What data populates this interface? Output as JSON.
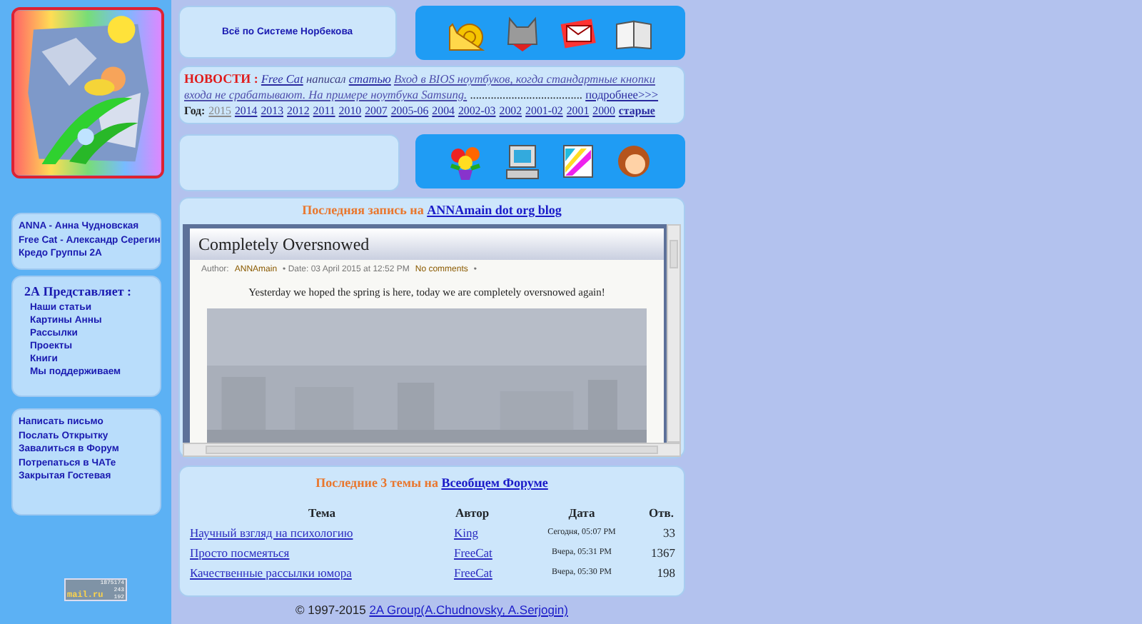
{
  "top_link": "Всё по Системе Норбекова",
  "news": {
    "label": "НОВОСТИ :",
    "author": "Free Cat",
    "verb": "написал",
    "article": "статью",
    "headline": [
      "Вход в BIOS ноутбуков, когда стандартные кнопки",
      "входа не срабатывают. На примере ноутбука Samsung."
    ],
    "dots": "......................................",
    "more": "подробнее>>>",
    "year_label": "Год:",
    "years": [
      {
        "label": "2015",
        "selected": true
      },
      {
        "label": "2014",
        "selected": false
      },
      {
        "label": "2013",
        "selected": false
      },
      {
        "label": "2012",
        "selected": false
      },
      {
        "label": "2011",
        "selected": false
      },
      {
        "label": "2010",
        "selected": false
      },
      {
        "label": "2007",
        "selected": false
      },
      {
        "label": "2005-06",
        "selected": false
      },
      {
        "label": "2004",
        "selected": false
      },
      {
        "label": "2002-03",
        "selected": false
      },
      {
        "label": "2002",
        "selected": false
      },
      {
        "label": "2001-02",
        "selected": false
      },
      {
        "label": "2001",
        "selected": false
      },
      {
        "label": "2000",
        "selected": false
      }
    ],
    "archive": "старые"
  },
  "sidebar": {
    "people": [
      "ANNA - Анна Чудновская",
      "Free Cat - Александр Серегин",
      "Кредо Группы 2A"
    ],
    "presents_title": "2А Представляет :",
    "presents": [
      "Наши статьи",
      "Картины Анны",
      "Рассылки",
      "Проекты",
      "Книги",
      "Мы поддерживаем"
    ],
    "contact": [
      "Написать письмо",
      "Послать Открытку",
      "Завалиться в Форум",
      "Потрепаться в ЧАТе",
      "Закрытая Гостевая"
    ],
    "counter": {
      "total": "1875174",
      "brand": "mail.ru",
      "values": [
        "243",
        "192"
      ]
    }
  },
  "blog": {
    "prefix": "Последняя запись на",
    "link": "ANNAmain dot org blog",
    "title": "Completely Oversnowed",
    "author_label": "Author:",
    "author": "ANNAmain",
    "date": "• Date: 03 April 2015 at 12:52 PM",
    "comments": "No comments",
    "tail": "•",
    "body": "Yesterday we hoped the spring is here, today we are completely oversnowed again!"
  },
  "forum": {
    "prefix": "Последние 3 темы на",
    "link": "Всеобщем Форуме",
    "columns": [
      "Тема",
      "Автор",
      "Дата",
      "Отв."
    ],
    "rows": [
      {
        "topic": "Научный взгляд на психологию",
        "author": "King",
        "date": "Сегодня, 05:07 PM",
        "replies": "33"
      },
      {
        "topic": "Просто посмеяться",
        "author": "FreeCat",
        "date": "Вчера, 05:31 PM",
        "replies": "1367"
      },
      {
        "topic": "Качественные рассылки юмора",
        "author": "FreeCat",
        "date": "Вчера, 05:30 PM",
        "replies": "198"
      }
    ]
  },
  "footer": {
    "copyright": "© 1997-2015",
    "link": "2A Group(A.Chudnovsky, A.Serjogin)"
  }
}
